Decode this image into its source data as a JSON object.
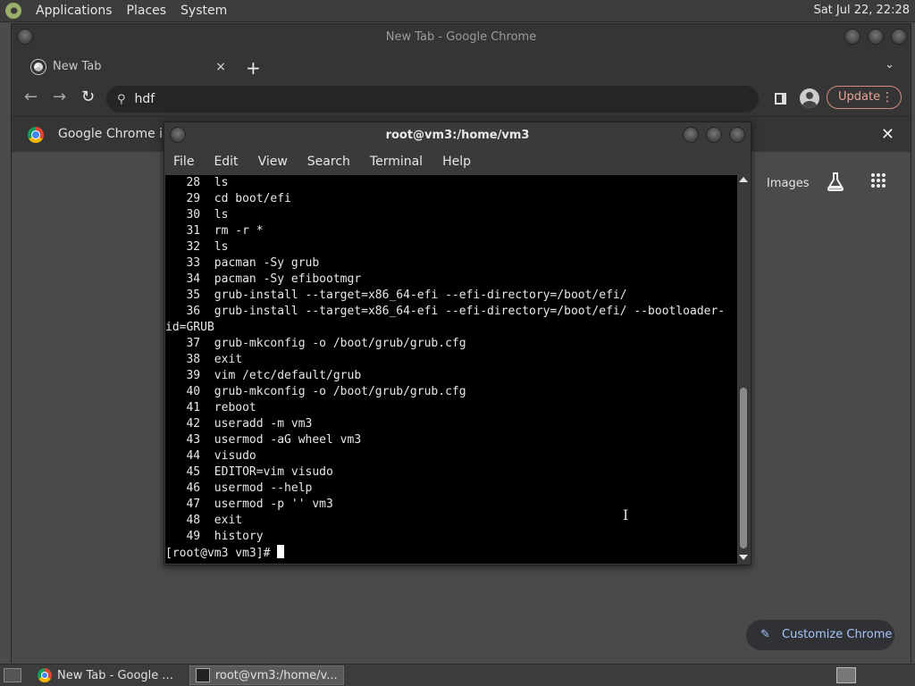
{
  "top_panel": {
    "menus": [
      "Applications",
      "Places",
      "System"
    ],
    "clock": "Sat Jul 22, 22:28"
  },
  "chrome": {
    "window_title": "New Tab - Google Chrome",
    "tab": {
      "title": "New Tab",
      "close": "×"
    },
    "newtab": "+",
    "tabsearch": "⌄",
    "omnibox_value": "hdf",
    "update_label": "Update",
    "infobar_text": "Google Chrome isn",
    "images_label": "Images",
    "customize_label": "Customize Chrome"
  },
  "terminal": {
    "title": "root@vm3:/home/vm3",
    "menu": [
      "File",
      "Edit",
      "View",
      "Search",
      "Terminal",
      "Help"
    ],
    "lines": [
      "   28  ls",
      "   29  cd boot/efi",
      "   30  ls",
      "   31  rm -r *",
      "   32  ls",
      "   33  pacman -Sy grub",
      "   34  pacman -Sy efibootmgr",
      "   35  grub-install --target=x86_64-efi --efi-directory=/boot/efi/",
      "   36  grub-install --target=x86_64-efi --efi-directory=/boot/efi/ --bootloader-",
      "id=GRUB",
      "   37  grub-mkconfig -o /boot/grub/grub.cfg",
      "   38  exit",
      "   39  vim /etc/default/grub",
      "   40  grub-mkconfig -o /boot/grub/grub.cfg",
      "   41  reboot",
      "   42  useradd -m vm3",
      "   43  usermod -aG wheel vm3",
      "   44  visudo",
      "   45  EDITOR=vim visudo",
      "   46  usermod --help",
      "   47  usermod -p '' vm3",
      "   48  exit",
      "   49  history"
    ],
    "prompt": "[root@vm3 vm3]# "
  },
  "taskbar": {
    "items": [
      {
        "label": "New Tab - Google ...",
        "icon": "chrome-icon"
      },
      {
        "label": "root@vm3:/home/v...",
        "icon": "terminal-icon"
      }
    ]
  }
}
